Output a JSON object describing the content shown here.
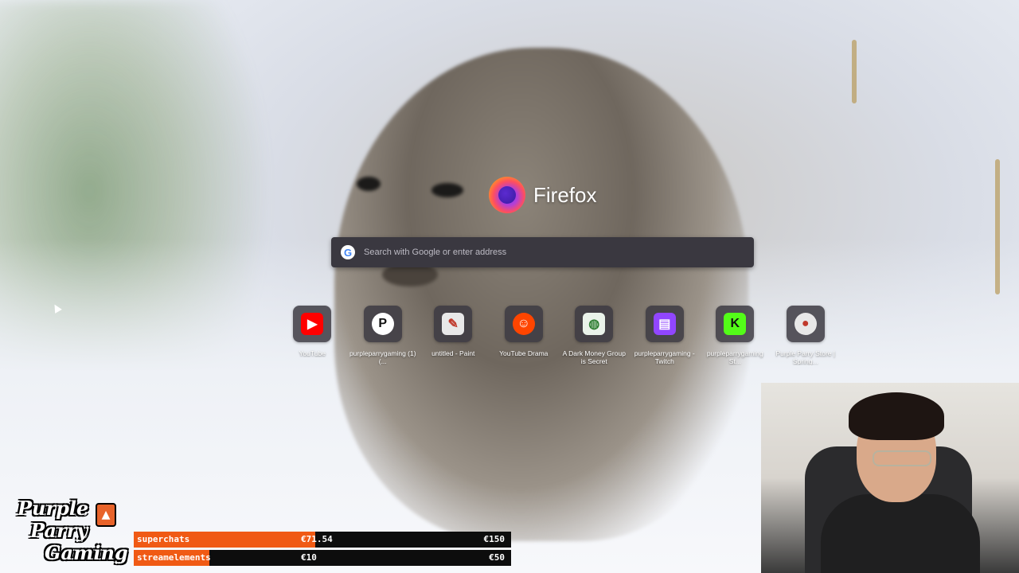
{
  "newtab": {
    "brand": "Firefox",
    "search_placeholder": "Search with Google or enter address"
  },
  "top_sites": [
    {
      "label": "YouTube",
      "icon": "youtube-icon",
      "color": "#ff0000"
    },
    {
      "label": "purpleparrygaming (1) (...",
      "icon": "patreon-icon",
      "color": "#ffffff"
    },
    {
      "label": "untitled - Paint",
      "icon": "paint-icon",
      "color": "#e0e0e0"
    },
    {
      "label": "YouTube Drama",
      "icon": "reddit-icon",
      "color": "#ff4500"
    },
    {
      "label": "A Dark Money Group is Secret",
      "icon": "globe-icon",
      "color": "#2e7d32"
    },
    {
      "label": "purpleparrygaming - Twitch",
      "icon": "twitch-icon",
      "color": "#9146ff"
    },
    {
      "label": "purpleparrygaming St...",
      "icon": "kick-icon",
      "color": "#53fc18"
    },
    {
      "label": "Purple Parry Store | Spring...",
      "icon": "store-icon",
      "color": "#c0392b"
    }
  ],
  "stream": {
    "brand_lines": [
      "Purple",
      "Parry",
      "Gaming"
    ],
    "bars": [
      {
        "name": "superchats",
        "current": "€71.54",
        "goal": "€150",
        "fill": 0.48
      },
      {
        "name": "streamelements",
        "current": "€10",
        "goal": "€50",
        "fill": 0.2
      }
    ]
  }
}
